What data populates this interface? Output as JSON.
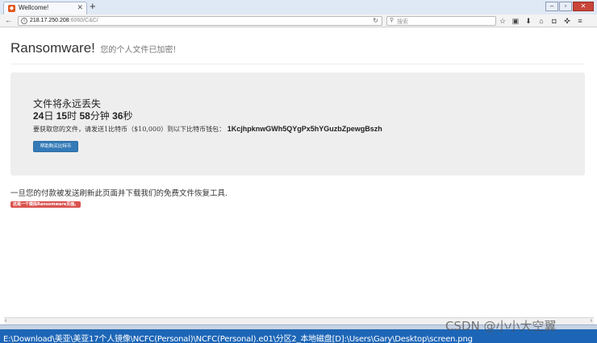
{
  "browser": {
    "tab_title": "Wellcome!",
    "tab_favicon": "firefox-page-icon",
    "new_tab_label": "+",
    "url_host": "218.17.250.208",
    "url_path": ":6060/C&C/",
    "search_placeholder": "搜索",
    "toolbar_icons": [
      "star-icon",
      "clipboard-icon",
      "download-icon",
      "home-icon",
      "pocket-icon",
      "extension-icon",
      "menu-icon"
    ]
  },
  "page": {
    "title": "Ransomware!",
    "subtitle": "您的个人文件已加密!",
    "warning_title": "文件将永远丢失",
    "countdown": {
      "days": "24",
      "days_unit": "日",
      "hours": "15",
      "hours_unit": "时",
      "minutes": "58",
      "minutes_unit": "分钟",
      "seconds": "36",
      "seconds_unit": "秒"
    },
    "instruction": "要获取您的文件，请发送1比特币（$10,000）到以下比特币钱包：",
    "wallet_address": "1KcjhpknwGWh5QYgPx5hYGuzbZpewgBszh",
    "button_label": "帮助购买比特币",
    "after_payment_text": "一旦您的付款被发送刷新此页面并下载我们的免费文件恢复工具.",
    "danger_label": "这是一个模拟Ransomware页面。"
  },
  "statusbar": {
    "path": "E:\\Download\\美亚\\美亚17个人镜像\\NCFC(Personal)\\NCFC(Personal).e01\\分区2_本地磁盘[D]:\\Users\\Gary\\Desktop\\screen.png"
  },
  "watermark": "CSDN @小小大空翼",
  "colors": {
    "primary": "#337ab7",
    "danger": "#d9534f",
    "jumbotron": "#eeeeee",
    "statusbar": "#1d66b7"
  }
}
